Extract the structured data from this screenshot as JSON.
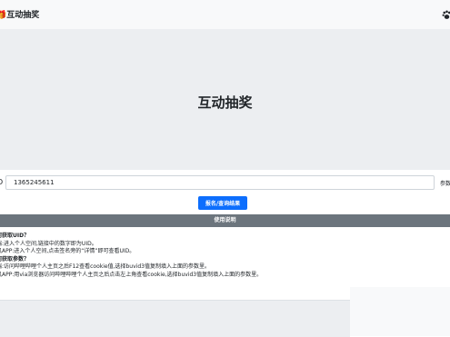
{
  "navbar": {
    "brand": "🎁互动抽奖",
    "icon": "paw-icon"
  },
  "hero": {
    "title": "互动抽奖"
  },
  "form": {
    "uid_prefix": "D",
    "uid_value": "1365245611",
    "suffix": "参数",
    "submit_label": "报名/查询结果"
  },
  "usage": {
    "header": "使用说明",
    "lines": [
      "何获取UID？",
      "端:进入个人空间,链接中的数字即为UID。",
      "机APP:进入个人空间,点击签名旁的“详情”即可查看UID。",
      "何获取参数？",
      "端:访问哔哩哔哩个人主页之后F12查看cookie值,选择buvid3值复制填入上面的参数里。",
      "机APP:用via浏览器访问哔哩哔哩个人主页之后点击左上角查看cookie,选择buvid3值复制填入上面的参数里。"
    ]
  }
}
